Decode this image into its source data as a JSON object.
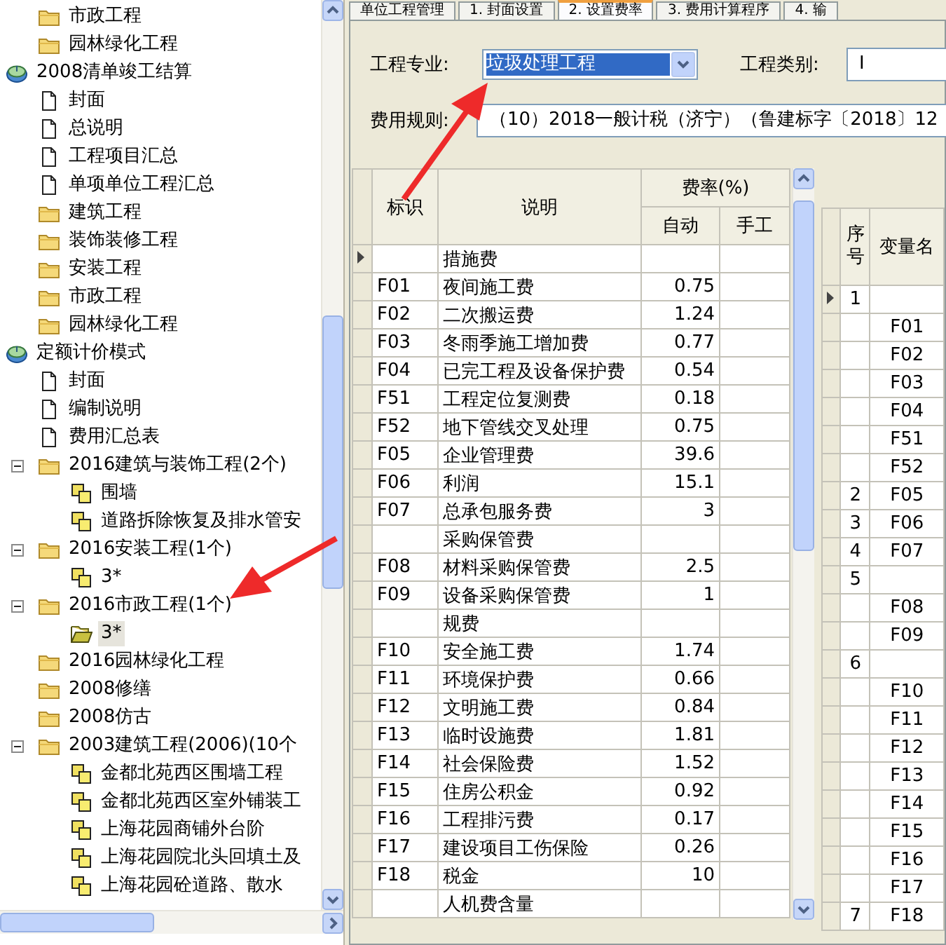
{
  "tree": [
    {
      "children": [
        {
          "label": "市政工程",
          "kind": "folder",
          "selected": false
        },
        {
          "label": "园林绿化工程",
          "kind": "folder",
          "selected": false
        }
      ]
    },
    {
      "label": "2008清单竣工结算",
      "kind": "root",
      "selected": false,
      "children": [
        {
          "label": "封面",
          "kind": "doc",
          "selected": false
        },
        {
          "label": "总说明",
          "kind": "doc",
          "selected": false
        },
        {
          "label": "工程项目汇总",
          "kind": "doc",
          "selected": false
        },
        {
          "label": "单项单位工程汇总",
          "kind": "doc",
          "selected": false
        },
        {
          "label": "建筑工程",
          "kind": "folder",
          "selected": false
        },
        {
          "label": "装饰装修工程",
          "kind": "folder",
          "selected": false
        },
        {
          "label": "安装工程",
          "kind": "folder",
          "selected": false
        },
        {
          "label": "市政工程",
          "kind": "folder",
          "selected": false
        },
        {
          "label": "园林绿化工程",
          "kind": "folder",
          "selected": false
        }
      ]
    },
    {
      "label": "定额计价模式",
      "kind": "root",
      "selected": false,
      "children": [
        {
          "label": "封面",
          "kind": "doc",
          "selected": false
        },
        {
          "label": "编制说明",
          "kind": "doc",
          "selected": false
        },
        {
          "label": "费用汇总表",
          "kind": "doc",
          "selected": false
        },
        {
          "label": "2016建筑与装饰工程(2个)",
          "kind": "folder",
          "expanded": true,
          "selected": false,
          "children": [
            {
              "label": "围墙",
              "kind": "unit",
              "selected": false
            },
            {
              "label": "道路拆除恢复及排水管安",
              "kind": "unit",
              "selected": false
            }
          ]
        },
        {
          "label": "2016安装工程(1个)",
          "kind": "folder",
          "expanded": true,
          "selected": false,
          "children": [
            {
              "label": "3*",
              "kind": "unit",
              "selected": false
            }
          ]
        },
        {
          "label": "2016市政工程(1个)",
          "kind": "folder",
          "expanded": true,
          "selected": false,
          "children": [
            {
              "label": "3*",
              "kind": "open-folder",
              "selected": true
            }
          ]
        },
        {
          "label": "2016园林绿化工程",
          "kind": "folder",
          "selected": false
        },
        {
          "label": "2008修缮",
          "kind": "folder",
          "selected": false
        },
        {
          "label": "2008仿古",
          "kind": "folder",
          "selected": false
        },
        {
          "label": "2003建筑工程(2006)(10个",
          "kind": "folder",
          "expanded": true,
          "selected": false,
          "children": [
            {
              "label": "金都北苑西区围墙工程",
              "kind": "unit",
              "selected": false
            },
            {
              "label": "金都北苑西区室外铺装工",
              "kind": "unit",
              "selected": false
            },
            {
              "label": "上海花园商铺外台阶",
              "kind": "unit",
              "selected": false
            },
            {
              "label": "上海花园院北头回填土及",
              "kind": "unit",
              "selected": false
            },
            {
              "label": "上海花园砼道路、散水",
              "kind": "unit",
              "selected": false
            }
          ]
        }
      ]
    }
  ],
  "tabs": [
    {
      "label": "单位工程管理",
      "selected": false
    },
    {
      "label": "1. 封面设置",
      "selected": false
    },
    {
      "label": "2. 设置费率",
      "selected": true
    },
    {
      "label": "3. 费用计算程序",
      "selected": false
    },
    {
      "label": "4. 输",
      "selected": false
    }
  ],
  "form": {
    "specialty": {
      "label": "工程专业:",
      "value": "垃圾处理工程"
    },
    "category": {
      "label": "工程类别:",
      "value": "I"
    },
    "fee_rule": {
      "label": "费用规则:",
      "value": "（10）2018一般计税（济宁）（鲁建标字〔2018〕12"
    }
  },
  "rate_table": {
    "columns": {
      "id": "标识",
      "desc": "说明",
      "rate": "费率(%)",
      "auto": "自动",
      "manual": "手工"
    },
    "rows": [
      {
        "id": "",
        "desc": "措施费",
        "auto": "",
        "current": true
      },
      {
        "id": "F01",
        "desc": "夜间施工费",
        "auto": "0.75",
        "current": false
      },
      {
        "id": "F02",
        "desc": "二次搬运费",
        "auto": "1.24",
        "current": false
      },
      {
        "id": "F03",
        "desc": "冬雨季施工增加费",
        "auto": "0.77",
        "current": false
      },
      {
        "id": "F04",
        "desc": "已完工程及设备保护费",
        "auto": "0.54",
        "current": false
      },
      {
        "id": "F51",
        "desc": "工程定位复测费",
        "auto": "0.18",
        "current": false
      },
      {
        "id": "F52",
        "desc": "地下管线交叉处理",
        "auto": "0.75",
        "current": false
      },
      {
        "id": "F05",
        "desc": "企业管理费",
        "auto": "39.6",
        "current": false
      },
      {
        "id": "F06",
        "desc": "利润",
        "auto": "15.1",
        "current": false
      },
      {
        "id": "F07",
        "desc": "总承包服务费",
        "auto": "3",
        "current": false
      },
      {
        "id": "",
        "desc": "采购保管费",
        "auto": "",
        "current": false
      },
      {
        "id": "F08",
        "desc": "材料采购保管费",
        "auto": "2.5",
        "current": false
      },
      {
        "id": "F09",
        "desc": "设备采购保管费",
        "auto": "1",
        "current": false
      },
      {
        "id": "",
        "desc": "规费",
        "auto": "",
        "current": false
      },
      {
        "id": "F10",
        "desc": "安全施工费",
        "auto": "1.74",
        "current": false
      },
      {
        "id": "F11",
        "desc": "环境保护费",
        "auto": "0.66",
        "current": false
      },
      {
        "id": "F12",
        "desc": "文明施工费",
        "auto": "0.84",
        "current": false
      },
      {
        "id": "F13",
        "desc": "临时设施费",
        "auto": "1.81",
        "current": false
      },
      {
        "id": "F14",
        "desc": "社会保险费",
        "auto": "1.52",
        "current": false
      },
      {
        "id": "F15",
        "desc": "住房公积金",
        "auto": "0.92",
        "current": false
      },
      {
        "id": "F16",
        "desc": "工程排污费",
        "auto": "0.17",
        "current": false
      },
      {
        "id": "F17",
        "desc": "建设项目工伤保险",
        "auto": "0.26",
        "current": false
      },
      {
        "id": "F18",
        "desc": "税金",
        "auto": "10",
        "current": false
      },
      {
        "id": "",
        "desc": "人机费含量",
        "auto": "",
        "current": false
      }
    ]
  },
  "variable_table": {
    "columns": [
      "序号",
      "变量名"
    ],
    "rows": [
      {
        "no": "1",
        "var": "",
        "current": true
      },
      {
        "no": "",
        "var": "F01",
        "current": false
      },
      {
        "no": "",
        "var": "F02",
        "current": false
      },
      {
        "no": "",
        "var": "F03",
        "current": false
      },
      {
        "no": "",
        "var": "F04",
        "current": false
      },
      {
        "no": "",
        "var": "F51",
        "current": false
      },
      {
        "no": "",
        "var": "F52",
        "current": false
      },
      {
        "no": "2",
        "var": "F05",
        "current": false
      },
      {
        "no": "3",
        "var": "F06",
        "current": false
      },
      {
        "no": "4",
        "var": "F07",
        "current": false
      },
      {
        "no": "5",
        "var": "",
        "current": false
      },
      {
        "no": "",
        "var": "F08",
        "current": false
      },
      {
        "no": "",
        "var": "F09",
        "current": false
      },
      {
        "no": "6",
        "var": "",
        "current": false
      },
      {
        "no": "",
        "var": "F10",
        "current": false
      },
      {
        "no": "",
        "var": "F11",
        "current": false
      },
      {
        "no": "",
        "var": "F12",
        "current": false
      },
      {
        "no": "",
        "var": "F13",
        "current": false
      },
      {
        "no": "",
        "var": "F14",
        "current": false
      },
      {
        "no": "",
        "var": "F15",
        "current": false
      },
      {
        "no": "",
        "var": "F16",
        "current": false
      },
      {
        "no": "",
        "var": "F17",
        "current": false
      },
      {
        "no": "7",
        "var": "F18",
        "current": false
      }
    ]
  },
  "annotations": [
    {
      "kind": "arrow"
    },
    {
      "kind": "arrow"
    }
  ]
}
